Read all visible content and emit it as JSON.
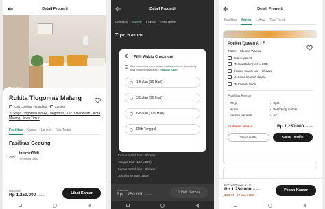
{
  "screens": {
    "detail": {
      "title": "Detail Properti",
      "property_name": "Rukita Tlogomas Malang",
      "type_label": "Kost Coliving · Standard",
      "gender_label": "Campur",
      "address": "Jl. Raya Tlogomas No.44, Tlogomas, Kec. Lowokwaru, Kota Malang, Jawa Timur",
      "tabs": [
        "Fasilitas",
        "Kamar",
        "Lokasi",
        "Tata Tertib"
      ],
      "section_title": "Fasilitas Gedung",
      "facility_name": "Internet/Wifi",
      "facility_status": "Tersedia di/ag",
      "price_from_label": "Mulai dari",
      "price": "Rp 1.250.000",
      "price_unit": "/bulan",
      "cta": "Lihat Kamar"
    },
    "checkout": {
      "title": "Detail Properti",
      "bg_tabs": [
        "Fasilitas",
        "Kamar",
        "Lokasi",
        "Tata Tertib"
      ],
      "bg_section": "Tipe Kamar",
      "bg_rows": [
        "Kamar mandi luar · Shower",
        "Tempat tidur (160 x 200)",
        "Kamar mandi luar · Shower",
        "Jendela ke arah dalam"
      ],
      "modal_title": "Pilih Waktu Check-out",
      "info_text": "Jika belum bisa menentukan waktu check-out, kamu tetap bisa booking melalui fitur",
      "info_link": "Hubungi Kami",
      "options": [
        "1 Bulan (30 Hari)",
        "3 Bulan (90 Hari)",
        "6 Bulan (120 Hari)",
        "Pilih Tanggal"
      ],
      "price_from_label": "Mulai dari",
      "price": "Rp 1.250.000",
      "price_unit": "/bulan",
      "cta": "Lihat Kamar"
    },
    "room": {
      "title": "Detail Properti",
      "tabs": [
        "Fasilitas",
        "Kamar",
        "Lokasi",
        "Tata Tertib"
      ],
      "room_name": "Pocket Queen A - F",
      "room_sub": "7.12m² · Khusus Wanita",
      "specs": [
        "Maks. pax: 1",
        "Tempat tidur (160 x 200)",
        "Kamar mandi luar · Shower",
        "Jendela ke arah dalam",
        "Termasuk listrik"
      ],
      "facility_title": "Fasilitas Kamar",
      "facilities": [
        "Meja",
        "Sprei",
        "Kursi",
        "Pelindung matras",
        "Lemari pakaian",
        "AC"
      ],
      "availability": "<5 Kamar tersisa",
      "price": "Rp 1.250.000",
      "price_unit": "/bulan",
      "btn_ask": "Tanya di WA",
      "btn_select": "Kamar Terpilih",
      "footer_room": "Pocket Queen A - F",
      "footer_price": "Rp 1.250.000",
      "footer_unit": "/bulan",
      "footer_dates": "19 Des - 17 Jan 2023",
      "footer_cta": "Pesan Kamar"
    }
  },
  "colors": {
    "accent": "#1d8a6d",
    "dark": "#1c1c1c",
    "warning": "#d9432f"
  }
}
